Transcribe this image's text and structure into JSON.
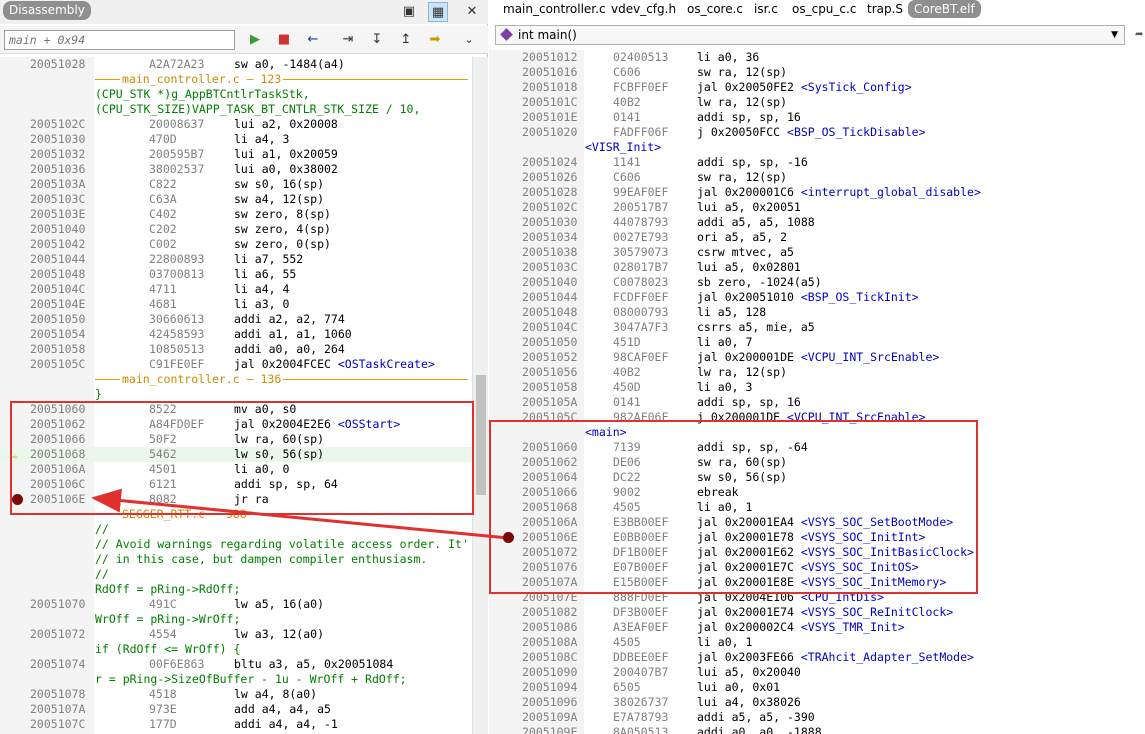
{
  "left_panel": {
    "title": "Disassembly",
    "address_placeholder": "main + 0x94",
    "rows": [
      {
        "kind": "ins",
        "addr": "20051028",
        "hex": "A2A72A23",
        "ins": "sw a0, -1484(a4)"
      },
      {
        "kind": "sep",
        "label": "main_controller.c — 123"
      },
      {
        "kind": "src",
        "text": "(CPU_STK *)g_AppBTCntlrTaskStk,"
      },
      {
        "kind": "src",
        "text": "(CPU_STK_SIZE)VAPP_TASK_BT_CNTLR_STK_SIZE / 10,"
      },
      {
        "kind": "ins",
        "addr": "2005102C",
        "hex": "20008637",
        "ins": "lui a2, 0x20008"
      },
      {
        "kind": "ins",
        "addr": "20051030",
        "hex": "470D",
        "ins": "li a4, 3"
      },
      {
        "kind": "ins",
        "addr": "20051032",
        "hex": "200595B7",
        "ins": "lui a1, 0x20059"
      },
      {
        "kind": "ins",
        "addr": "20051036",
        "hex": "38002537",
        "ins": "lui a0, 0x38002"
      },
      {
        "kind": "ins",
        "addr": "2005103A",
        "hex": "C822",
        "ins": "sw s0, 16(sp)"
      },
      {
        "kind": "ins",
        "addr": "2005103C",
        "hex": "C63A",
        "ins": "sw a4, 12(sp)"
      },
      {
        "kind": "ins",
        "addr": "2005103E",
        "hex": "C402",
        "ins": "sw zero, 8(sp)"
      },
      {
        "kind": "ins",
        "addr": "20051040",
        "hex": "C202",
        "ins": "sw zero, 4(sp)"
      },
      {
        "kind": "ins",
        "addr": "20051042",
        "hex": "C002",
        "ins": "sw zero, 0(sp)"
      },
      {
        "kind": "ins",
        "addr": "20051044",
        "hex": "22800893",
        "ins": "li a7, 552"
      },
      {
        "kind": "ins",
        "addr": "20051048",
        "hex": "03700813",
        "ins": "li a6, 55"
      },
      {
        "kind": "ins",
        "addr": "2005104C",
        "hex": "4711",
        "ins": "li a4, 4"
      },
      {
        "kind": "ins",
        "addr": "2005104E",
        "hex": "4681",
        "ins": "li a3, 0"
      },
      {
        "kind": "ins",
        "addr": "20051050",
        "hex": "30660613",
        "ins": "addi a2, a2, 774"
      },
      {
        "kind": "ins",
        "addr": "20051054",
        "hex": "42458593",
        "ins": "addi a1, a1, 1060"
      },
      {
        "kind": "ins",
        "addr": "20051058",
        "hex": "10850513",
        "ins": "addi a0, a0, 264"
      },
      {
        "kind": "ins",
        "addr": "2005105C",
        "hex": "C91FE0EF",
        "ins": "jal 0x2004FCEC ",
        "sym": "<OSTaskCreate>"
      },
      {
        "kind": "sep",
        "label": "main_controller.c — 136"
      },
      {
        "kind": "src",
        "text": "}"
      },
      {
        "kind": "ins",
        "addr": "20051060",
        "hex": "8522",
        "ins": "mv a0, s0"
      },
      {
        "kind": "ins",
        "addr": "20051062",
        "hex": "A84FD0EF",
        "ins": "jal 0x2004E2E6 ",
        "sym": "<OSStart>"
      },
      {
        "kind": "ins",
        "addr": "20051066",
        "hex": "50F2",
        "ins": "lw ra, 60(sp)"
      },
      {
        "kind": "ins",
        "addr": "20051068",
        "hex": "5462",
        "ins": "lw s0, 56(sp)",
        "current": true
      },
      {
        "kind": "ins",
        "addr": "2005106A",
        "hex": "4501",
        "ins": "li a0, 0"
      },
      {
        "kind": "ins",
        "addr": "2005106C",
        "hex": "6121",
        "ins": "addi sp, sp, 64"
      },
      {
        "kind": "ins",
        "addr": "2005106E",
        "hex": "8082",
        "ins": "jr ra",
        "breakpoint": true
      },
      {
        "kind": "sep",
        "label": "SEGGER_RTT.c — 388"
      },
      {
        "kind": "src",
        "text": "//"
      },
      {
        "kind": "src",
        "text": "// Avoid warnings regarding volatile access order. It'"
      },
      {
        "kind": "src",
        "text": "// in this case, but dampen compiler enthusiasm."
      },
      {
        "kind": "src",
        "text": "//"
      },
      {
        "kind": "src",
        "text": "RdOff = pRing->RdOff;"
      },
      {
        "kind": "ins",
        "addr": "20051070",
        "hex": "491C",
        "ins": "lw a5, 16(a0)"
      },
      {
        "kind": "src",
        "text": "WrOff = pRing->WrOff;"
      },
      {
        "kind": "ins",
        "addr": "20051072",
        "hex": "4554",
        "ins": "lw a3, 12(a0)"
      },
      {
        "kind": "src",
        "text": "if (RdOff <= WrOff) {"
      },
      {
        "kind": "ins",
        "addr": "20051074",
        "hex": "00F6E863",
        "ins": "bltu a3, a5, 0x20051084"
      },
      {
        "kind": "src",
        "text": "r = pRing->SizeOfBuffer - 1u - WrOff + RdOff;"
      },
      {
        "kind": "ins",
        "addr": "20051078",
        "hex": "4518",
        "ins": "lw a4, 8(a0)"
      },
      {
        "kind": "ins",
        "addr": "2005107A",
        "hex": "973E",
        "ins": "add a4, a4, a5"
      },
      {
        "kind": "ins",
        "addr": "2005107C",
        "hex": "177D",
        "ins": "addi a4, a4, -1"
      }
    ]
  },
  "right_panel": {
    "tabs": [
      "main_controller.c",
      "vdev_cfg.h",
      "os_core.c",
      "isr.c",
      "os_cpu_c.c",
      "trap.S",
      "CoreBT.elf"
    ],
    "active_tab": "CoreBT.elf",
    "function_selector": "int main()",
    "rows": [
      {
        "kind": "ins",
        "addr": "20051012",
        "hex": "02400513",
        "ins": "li a0, 36"
      },
      {
        "kind": "ins",
        "addr": "20051016",
        "hex": "C606",
        "ins": "sw ra, 12(sp)"
      },
      {
        "kind": "ins",
        "addr": "20051018",
        "hex": "FCBFF0EF",
        "ins": "jal 0x20050FE2 ",
        "sym": "<SysTick_Config>"
      },
      {
        "kind": "ins",
        "addr": "2005101C",
        "hex": "40B2",
        "ins": "lw ra, 12(sp)"
      },
      {
        "kind": "ins",
        "addr": "2005101E",
        "hex": "0141",
        "ins": "addi sp, sp, 16"
      },
      {
        "kind": "ins",
        "addr": "20051020",
        "hex": "FADFF06F",
        "ins": "j 0x20050FCC ",
        "sym": "<BSP_OS_TickDisable>"
      },
      {
        "kind": "label",
        "text": "<VISR_Init>"
      },
      {
        "kind": "ins",
        "addr": "20051024",
        "hex": "1141",
        "ins": "addi sp, sp, -16"
      },
      {
        "kind": "ins",
        "addr": "20051026",
        "hex": "C606",
        "ins": "sw ra, 12(sp)"
      },
      {
        "kind": "ins",
        "addr": "20051028",
        "hex": "99EAF0EF",
        "ins": "jal 0x200001C6 ",
        "sym": "<interrupt_global_disable>"
      },
      {
        "kind": "ins",
        "addr": "2005102C",
        "hex": "200517B7",
        "ins": "lui a5, 0x20051"
      },
      {
        "kind": "ins",
        "addr": "20051030",
        "hex": "44078793",
        "ins": "addi a5, a5, 1088"
      },
      {
        "kind": "ins",
        "addr": "20051034",
        "hex": "0027E793",
        "ins": "ori a5, a5, 2"
      },
      {
        "kind": "ins",
        "addr": "20051038",
        "hex": "30579073",
        "ins": "csrw mtvec, a5"
      },
      {
        "kind": "ins",
        "addr": "2005103C",
        "hex": "028017B7",
        "ins": "lui a5, 0x02801"
      },
      {
        "kind": "ins",
        "addr": "20051040",
        "hex": "C0078023",
        "ins": "sb zero, -1024(a5)"
      },
      {
        "kind": "ins",
        "addr": "20051044",
        "hex": "FCDFF0EF",
        "ins": "jal 0x20051010 ",
        "sym": "<BSP_OS_TickInit>"
      },
      {
        "kind": "ins",
        "addr": "20051048",
        "hex": "08000793",
        "ins": "li a5, 128"
      },
      {
        "kind": "ins",
        "addr": "2005104C",
        "hex": "3047A7F3",
        "ins": "csrrs a5, mie, a5"
      },
      {
        "kind": "ins",
        "addr": "20051050",
        "hex": "451D",
        "ins": "li a0, 7"
      },
      {
        "kind": "ins",
        "addr": "20051052",
        "hex": "98CAF0EF",
        "ins": "jal 0x200001DE ",
        "sym": "<VCPU_INT_SrcEnable>"
      },
      {
        "kind": "ins",
        "addr": "20051056",
        "hex": "40B2",
        "ins": "lw ra, 12(sp)"
      },
      {
        "kind": "ins",
        "addr": "20051058",
        "hex": "450D",
        "ins": "li a0, 3"
      },
      {
        "kind": "ins",
        "addr": "2005105A",
        "hex": "0141",
        "ins": "addi sp, sp, 16"
      },
      {
        "kind": "ins",
        "addr": "2005105C",
        "hex": "982AF06F",
        "ins": "j 0x200001DE ",
        "sym": "<VCPU_INT_SrcEnable>"
      },
      {
        "kind": "label",
        "text": "<main>"
      },
      {
        "kind": "ins",
        "addr": "20051060",
        "hex": "7139",
        "ins": "addi sp, sp, -64"
      },
      {
        "kind": "ins",
        "addr": "20051062",
        "hex": "DE06",
        "ins": "sw ra, 60(sp)"
      },
      {
        "kind": "ins",
        "addr": "20051064",
        "hex": "DC22",
        "ins": "sw s0, 56(sp)"
      },
      {
        "kind": "ins",
        "addr": "20051066",
        "hex": "9002",
        "ins": "ebreak"
      },
      {
        "kind": "ins",
        "addr": "20051068",
        "hex": "4505",
        "ins": "li a0, 1"
      },
      {
        "kind": "ins",
        "addr": "2005106A",
        "hex": "E3BB00EF",
        "ins": "jal 0x20001EA4 ",
        "sym": "<VSYS_SOC_SetBootMode>"
      },
      {
        "kind": "ins",
        "addr": "2005106E",
        "hex": "E0BB00EF",
        "ins": "jal 0x20001E78 ",
        "sym": "<VSYS_SOC_InitInt>",
        "breakpoint": true
      },
      {
        "kind": "ins",
        "addr": "20051072",
        "hex": "DF1B00EF",
        "ins": "jal 0x20001E62 ",
        "sym": "<VSYS_SOC_InitBasicClock>"
      },
      {
        "kind": "ins",
        "addr": "20051076",
        "hex": "E07B00EF",
        "ins": "jal 0x20001E7C ",
        "sym": "<VSYS_SOC_InitOS>"
      },
      {
        "kind": "ins",
        "addr": "2005107A",
        "hex": "E15B00EF",
        "ins": "jal 0x20001E8E ",
        "sym": "<VSYS_SOC_InitMemory>"
      },
      {
        "kind": "ins",
        "addr": "2005107E",
        "hex": "888FD0EF",
        "ins": "jal 0x2004E106 ",
        "sym": "<CPU_IntDis>"
      },
      {
        "kind": "ins",
        "addr": "20051082",
        "hex": "DF3B00EF",
        "ins": "jal 0x20001E74 ",
        "sym": "<VSYS_SOC_ReInitClock>"
      },
      {
        "kind": "ins",
        "addr": "20051086",
        "hex": "A3EAF0EF",
        "ins": "jal 0x200002C4 ",
        "sym": "<VSYS_TMR_Init>"
      },
      {
        "kind": "ins",
        "addr": "2005108A",
        "hex": "4505",
        "ins": "li a0, 1"
      },
      {
        "kind": "ins",
        "addr": "2005108C",
        "hex": "DDBEE0EF",
        "ins": "jal 0x2003FE66 ",
        "sym": "<TRAhcit_Adapter_SetMode>"
      },
      {
        "kind": "ins",
        "addr": "20051090",
        "hex": "200407B7",
        "ins": "lui a5, 0x20040"
      },
      {
        "kind": "ins",
        "addr": "20051094",
        "hex": "6505",
        "ins": "lui a0, 0x01"
      },
      {
        "kind": "ins",
        "addr": "20051096",
        "hex": "38026737",
        "ins": "lui a4, 0x38026"
      },
      {
        "kind": "ins",
        "addr": "2005109A",
        "hex": "E7A78793",
        "ins": "addi a5, a5, -390"
      },
      {
        "kind": "ins",
        "addr": "2005109E",
        "hex": "8A050513",
        "ins": "addi a0, a0, -1888"
      }
    ]
  }
}
